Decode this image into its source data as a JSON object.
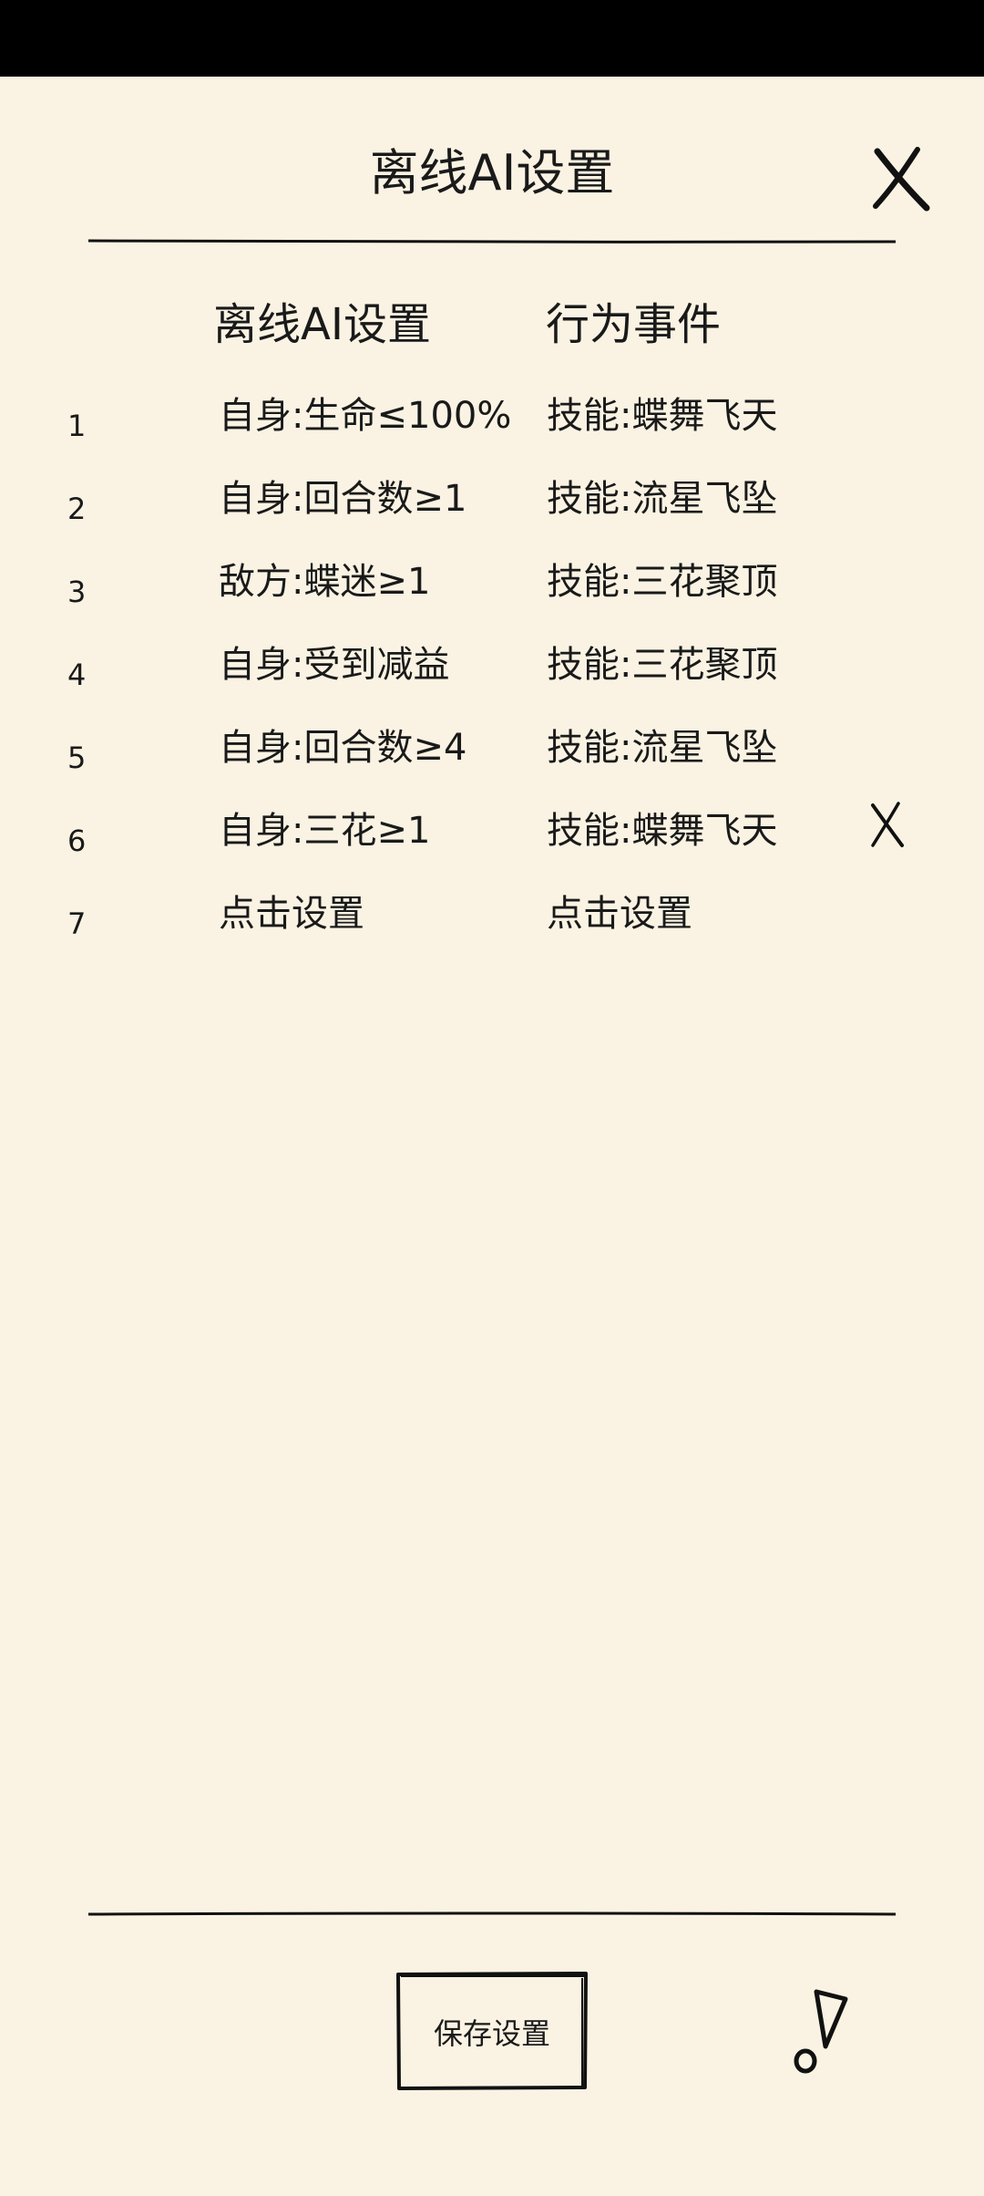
{
  "header": {
    "title": "离线AI设置"
  },
  "columns": {
    "condition": "离线AI设置",
    "action": "行为事件"
  },
  "rules": [
    {
      "index": "1",
      "condition": "自身:生命≤100%",
      "action": "技能:蝶舞飞天"
    },
    {
      "index": "2",
      "condition": "自身:回合数≥1",
      "action": "技能:流星飞坠"
    },
    {
      "index": "3",
      "condition": "敌方:蝶迷≥1",
      "action": "技能:三花聚顶"
    },
    {
      "index": "4",
      "condition": "自身:受到减益",
      "action": "技能:三花聚顶"
    },
    {
      "index": "5",
      "condition": "自身:回合数≥4",
      "action": "技能:流星飞坠"
    },
    {
      "index": "6",
      "condition": "自身:三花≥1",
      "action": "技能:蝶舞飞天"
    },
    {
      "index": "7",
      "condition": "点击设置",
      "action": "点击设置"
    }
  ],
  "footer": {
    "save_label": "保存设置"
  },
  "icons": {
    "close": "close-icon",
    "delete": "delete-icon",
    "help": "exclamation-icon"
  },
  "colors": {
    "background": "#faf3e3",
    "ink": "#1a1a1a",
    "status_bar": "#000000"
  }
}
